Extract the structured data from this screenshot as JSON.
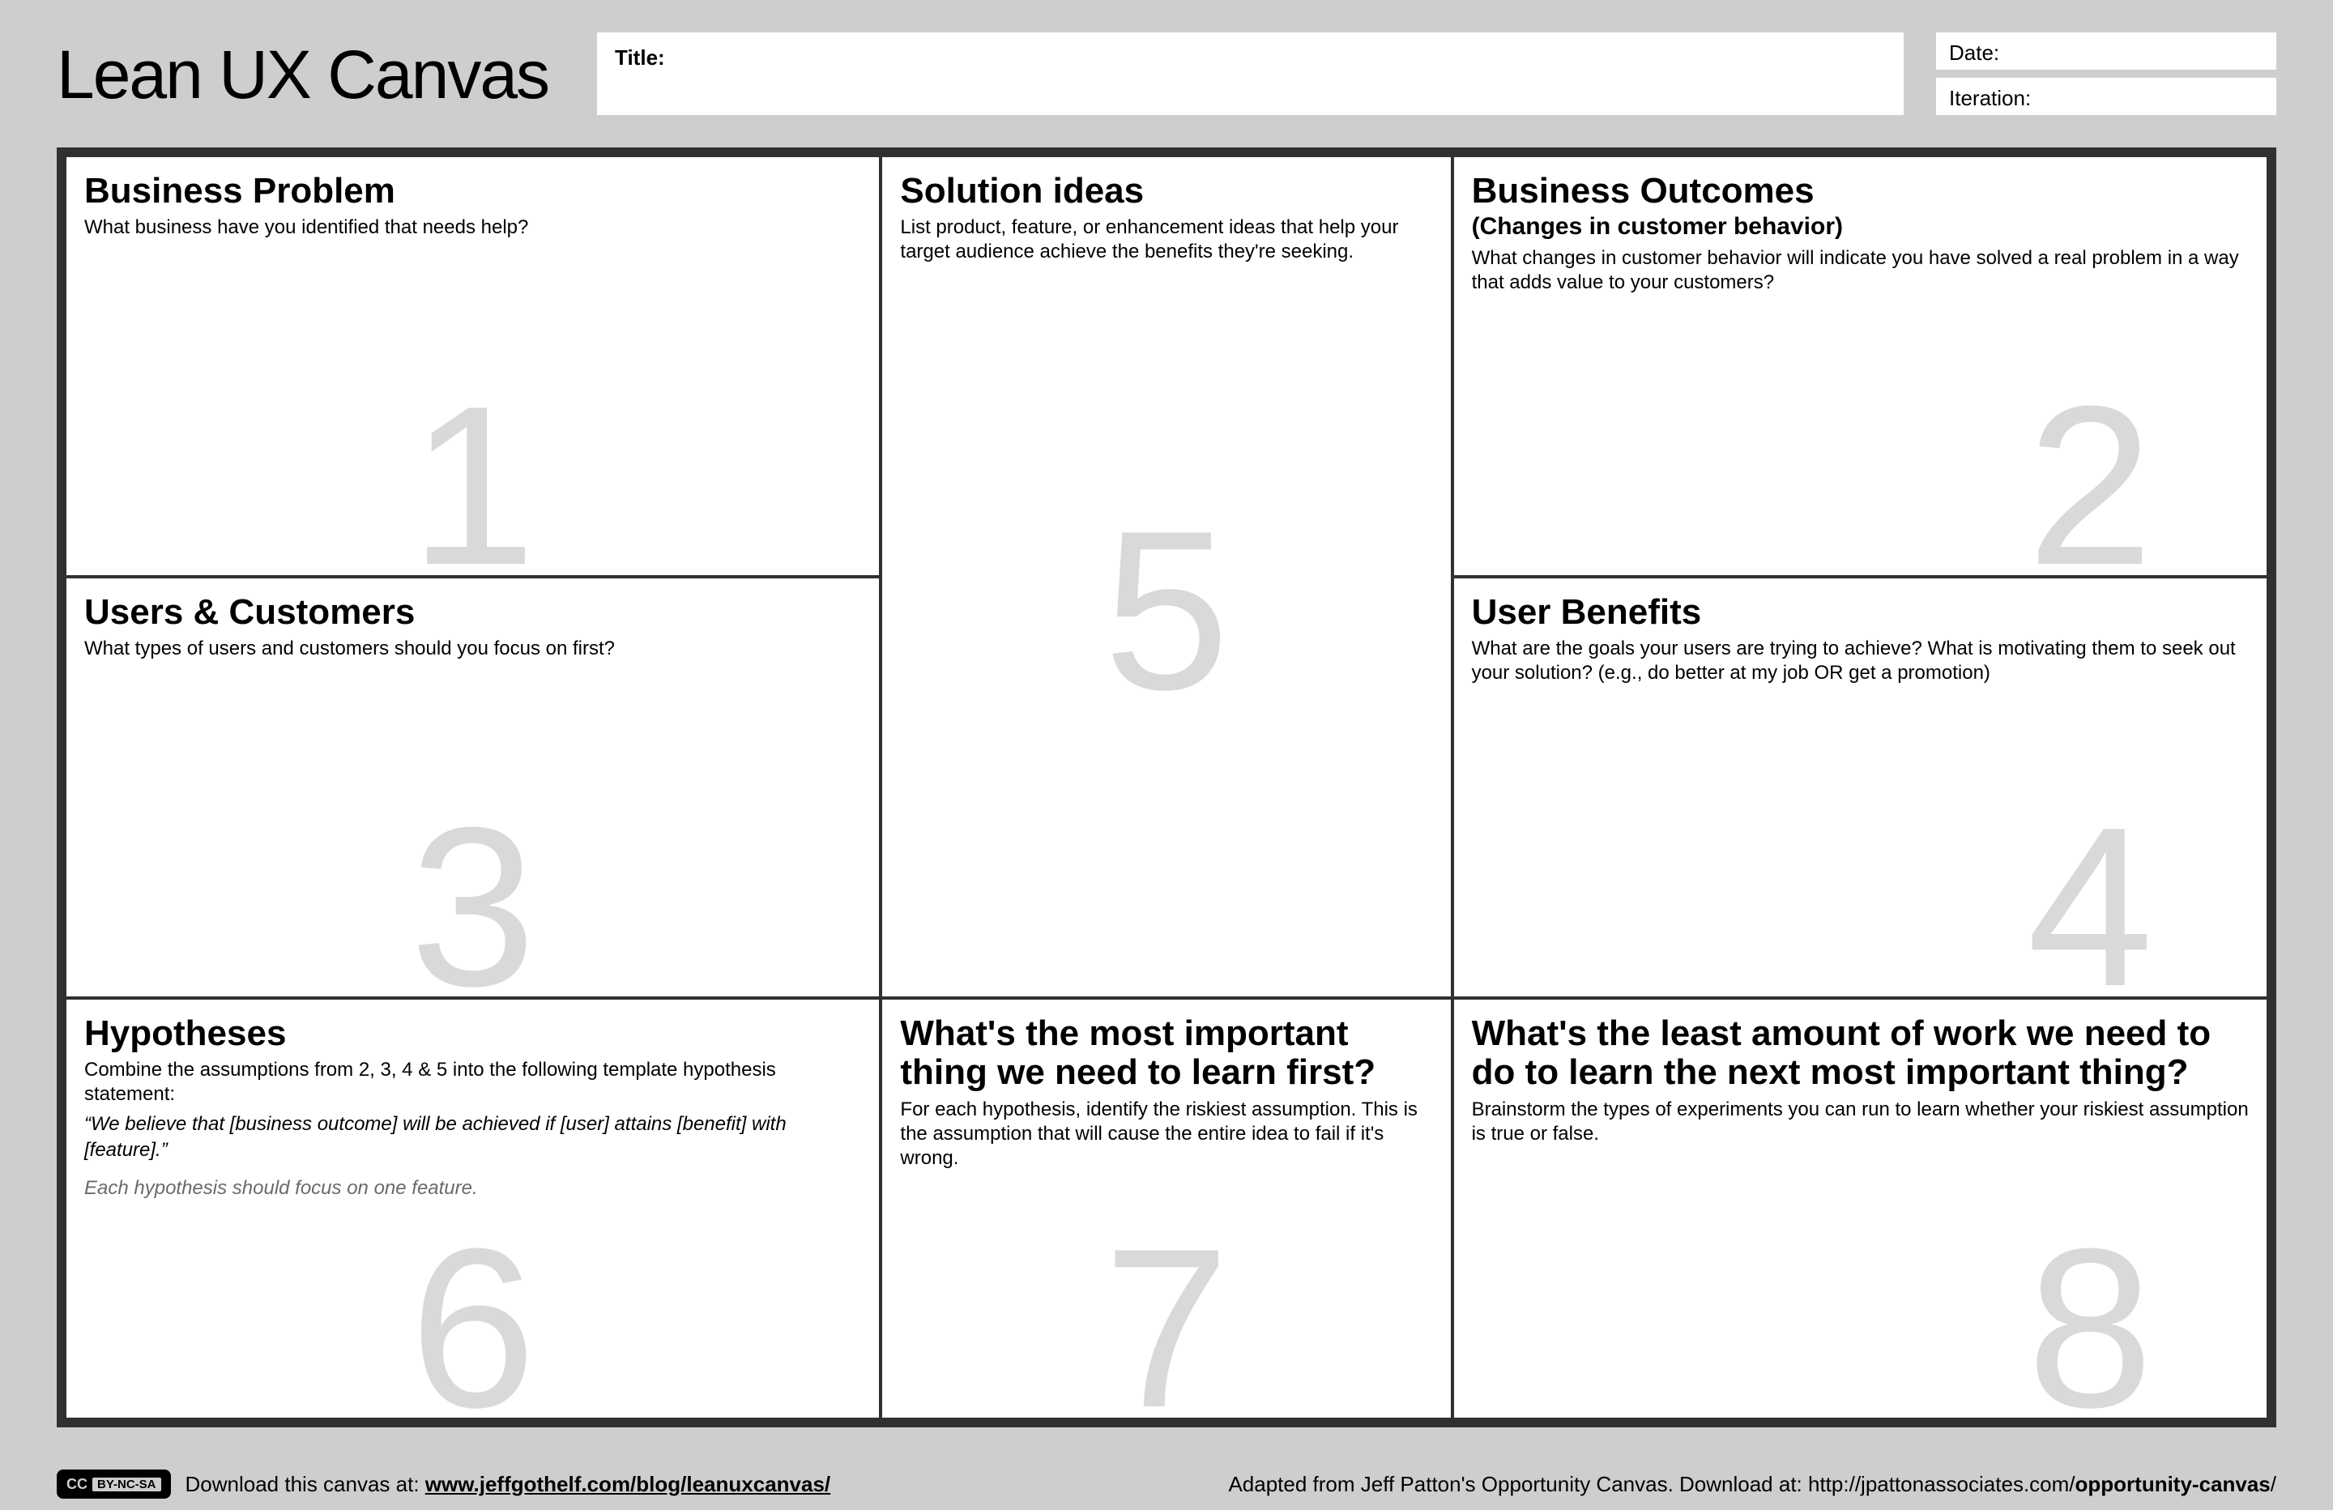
{
  "header": {
    "mainTitle": "Lean UX Canvas",
    "fields": {
      "titleLabel": "Title:",
      "dateLabel": "Date:",
      "iterationLabel": "Iteration:"
    }
  },
  "boxes": {
    "b1": {
      "title": "Business Problem",
      "help": "What business have you identified that needs help?",
      "num": "1"
    },
    "b2": {
      "title": "Business Outcomes",
      "subtitle": "(Changes in customer behavior)",
      "help": "What changes in customer behavior will indicate you have solved a real problem in a way that adds value to your customers?",
      "num": "2"
    },
    "b3": {
      "title": "Users & Customers",
      "help": "What types of users and customers should you focus on first?",
      "num": "3"
    },
    "b4": {
      "title": "User Benefits",
      "help": "What are the goals your users are trying to achieve? What is motivating them to seek out your solution? (e.g., do better at my job OR get a promotion)",
      "num": "4"
    },
    "b5": {
      "title": "Solution ideas",
      "help": "List product, feature, or enhancement ideas that help your target audience achieve the benefits they're seeking.",
      "num": "5"
    },
    "b6": {
      "title": "Hypotheses",
      "help": "Combine the assumptions from 2, 3, 4 & 5 into the following template hypothesis statement:",
      "helpItalic": "“We believe that [business outcome] will be achieved if [user] attains [benefit] with [feature].”",
      "helpItalicGrey": "Each hypothesis should focus on one feature.",
      "num": "6"
    },
    "b7": {
      "title": "What's the most important thing we need to learn first?",
      "help": "For each hypothesis, identify the riskiest assumption. This is the assumption that will cause the entire idea to fail if it's wrong.",
      "num": "7"
    },
    "b8": {
      "title": "What's the least amount of work we need to do to learn the next most important thing?",
      "help": "Brainstorm the types of experiments you can run to learn whether your riskiest assumption is true or false.",
      "num": "8"
    }
  },
  "footer": {
    "ccLabel": "CC",
    "ccTerms": "BY-NC-SA",
    "leftPrefix": "Download this canvas at: ",
    "leftLink": "www.jeffgothelf.com/blog/leanuxcanvas/",
    "rightPrefix": "Adapted from Jeff Patton's Opportunity Canvas. Download at:  ",
    "rightLinkBase": "http://jpattonassociates.com/",
    "rightLinkBold": "opportunity-canvas",
    "rightLinkSlash": "/"
  }
}
